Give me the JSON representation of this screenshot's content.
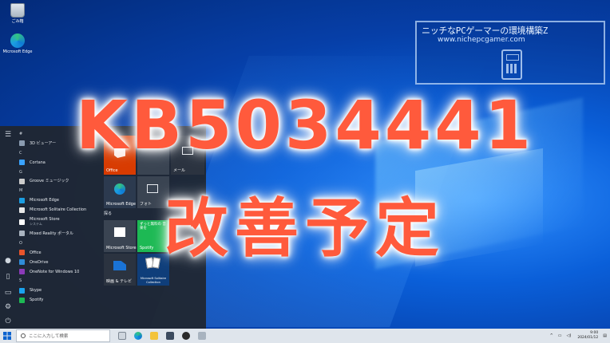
{
  "desktop": {
    "icons": [
      {
        "label": "ごみ箱",
        "icon": "recycle-bin-icon"
      },
      {
        "label": "Microsoft Edge",
        "icon": "edge-icon"
      }
    ],
    "accent": "#0a5fd9"
  },
  "watermark": {
    "title": "ニッチなPCゲーマーの環境構築Z",
    "url": "www.nichepcgamer.com"
  },
  "headline": {
    "line1": "KB5034441",
    "line2": "改善予定",
    "color": "#ff5a3c"
  },
  "start_menu": {
    "apps": [
      {
        "type": "header",
        "label": "#"
      },
      {
        "type": "app",
        "label": "3D ビューアー",
        "icon": "cube-icon",
        "color": "#8a9bb0"
      },
      {
        "type": "header",
        "label": "C"
      },
      {
        "type": "app",
        "label": "Cortana",
        "icon": "cortana-icon",
        "color": "#3aa3ff"
      },
      {
        "type": "header",
        "label": "G"
      },
      {
        "type": "app",
        "label": "Groove ミュージック",
        "icon": "groove-icon",
        "color": "#cccccc"
      },
      {
        "type": "header",
        "label": "M"
      },
      {
        "type": "app",
        "label": "Microsoft Edge",
        "icon": "edge-icon",
        "color": "#1b9de2"
      },
      {
        "type": "app",
        "label": "Microsoft Solitaire Collection",
        "icon": "cards-icon",
        "color": "#e8e8e8"
      },
      {
        "type": "app-sub",
        "label": "Microsoft Store",
        "sub": "システム",
        "icon": "store-icon",
        "color": "#ffffff"
      },
      {
        "type": "app",
        "label": "Mixed Reality ポータル",
        "icon": "mixed-reality-icon",
        "color": "#aab4c0"
      },
      {
        "type": "header",
        "label": "O"
      },
      {
        "type": "app",
        "label": "Office",
        "icon": "office-icon",
        "color": "#e8542b"
      },
      {
        "type": "app",
        "label": "OneDrive",
        "icon": "onedrive-icon",
        "color": "#2f8cd8"
      },
      {
        "type": "app",
        "label": "OneNote for Windows 10",
        "icon": "onenote-icon",
        "color": "#8b3ab8"
      },
      {
        "type": "header",
        "label": "S"
      },
      {
        "type": "app",
        "label": "Skype",
        "icon": "skype-icon",
        "color": "#1aa3ee"
      },
      {
        "type": "app",
        "label": "Spotify",
        "icon": "spotify-icon",
        "color": "#1db954"
      }
    ],
    "tiles": {
      "office_label": "Office",
      "mail_label": "メール",
      "edge_label": "Microsoft Edge",
      "photos_label": "フォト",
      "group_label": "探る",
      "store_label": "Microsoft Store",
      "spotify_label": "Spotify",
      "spotify_top_text": "ずっと無料の 音楽を",
      "movies_label": "映画 & テレビ",
      "solitaire_label": "Microsoft Solitaire Collection"
    }
  },
  "taskbar": {
    "search_placeholder": "ここに入力して検索",
    "time": "9:00",
    "date": "2024/01/12"
  }
}
